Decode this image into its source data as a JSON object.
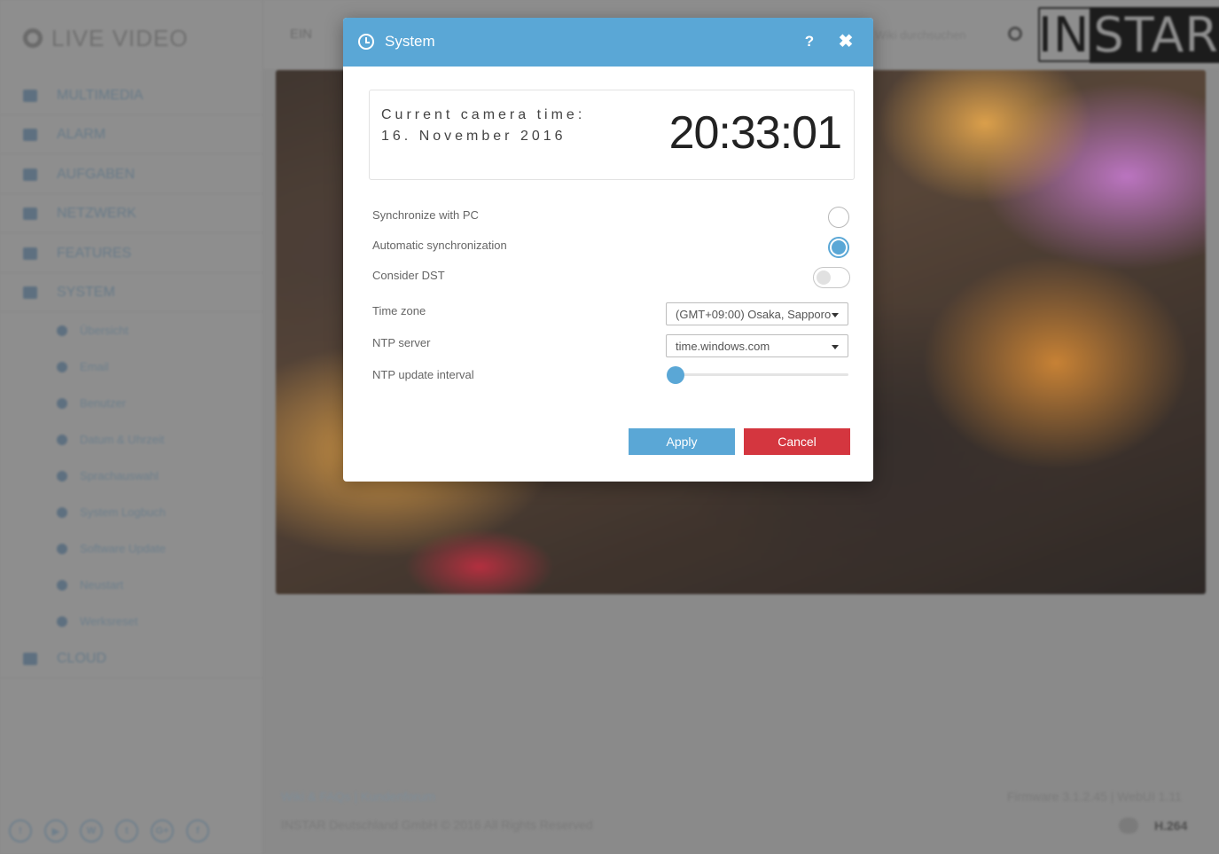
{
  "app": {
    "logo_text": "LIVE VIDEO",
    "sidebar": {
      "items": [
        {
          "label": "MULTIMEDIA",
          "icon": "image-icon"
        },
        {
          "label": "ALARM",
          "icon": "bell-icon"
        },
        {
          "label": "AUFGABEN",
          "icon": "calendar-icon"
        },
        {
          "label": "NETZWERK",
          "icon": "network-icon"
        },
        {
          "label": "FEATURES",
          "icon": "star-icon"
        },
        {
          "label": "SYSTEM",
          "icon": "gear-icon"
        }
      ],
      "sub_items": [
        {
          "label": "Übersicht",
          "icon": "monitor-icon"
        },
        {
          "label": "Email",
          "icon": "envelope-icon"
        },
        {
          "label": "Benutzer",
          "icon": "user-icon"
        },
        {
          "label": "Datum & Uhrzeit",
          "icon": "clock-icon"
        },
        {
          "label": "Sprachauswahl",
          "icon": "globe-icon"
        },
        {
          "label": "System Logbuch",
          "icon": "book-icon"
        },
        {
          "label": "Software Update",
          "icon": "refresh-icon"
        },
        {
          "label": "Neustart",
          "icon": "power-icon"
        },
        {
          "label": "Werksreset",
          "icon": "wrench-icon"
        }
      ],
      "cloud_label": "CLOUD",
      "social": [
        "warning",
        "youtube",
        "wordpress",
        "twitter",
        "google-plus",
        "facebook"
      ]
    },
    "topbar": {
      "left_text": "EIN",
      "search_text": "Wiki durchsuchen",
      "brand": "INSTAR"
    },
    "footer": {
      "links": "Wiki & FAQs | Kundenforum",
      "copyright": "INSTAR Deutschland GmbH © 2016 All Rights Reserved",
      "firmware": "Firmware 3.1.2.45 | WebUI 1.11",
      "codec": "H.264"
    }
  },
  "modal": {
    "title": "System",
    "help_label": "?",
    "close_label": "✖",
    "current_time_label": "Current camera time: 16. November 2016",
    "current_time_value": "20:33:01",
    "settings": {
      "sync_pc_label": "Synchronize with PC",
      "sync_pc_selected": false,
      "auto_sync_label": "Automatic synchronization",
      "auto_sync_selected": true,
      "dst_label": "Consider DST",
      "dst_enabled": false,
      "timezone_label": "Time zone",
      "timezone_value": "(GMT+09:00) Osaka, Sapporo",
      "ntp_server_label": "NTP server",
      "ntp_server_value": "time.windows.com",
      "ntp_interval_label": "NTP update interval",
      "ntp_interval_fraction": 0
    },
    "apply_label": "Apply",
    "cancel_label": "Cancel"
  },
  "colors": {
    "accent": "#5aa7d6",
    "cancel": "#d4363f"
  }
}
